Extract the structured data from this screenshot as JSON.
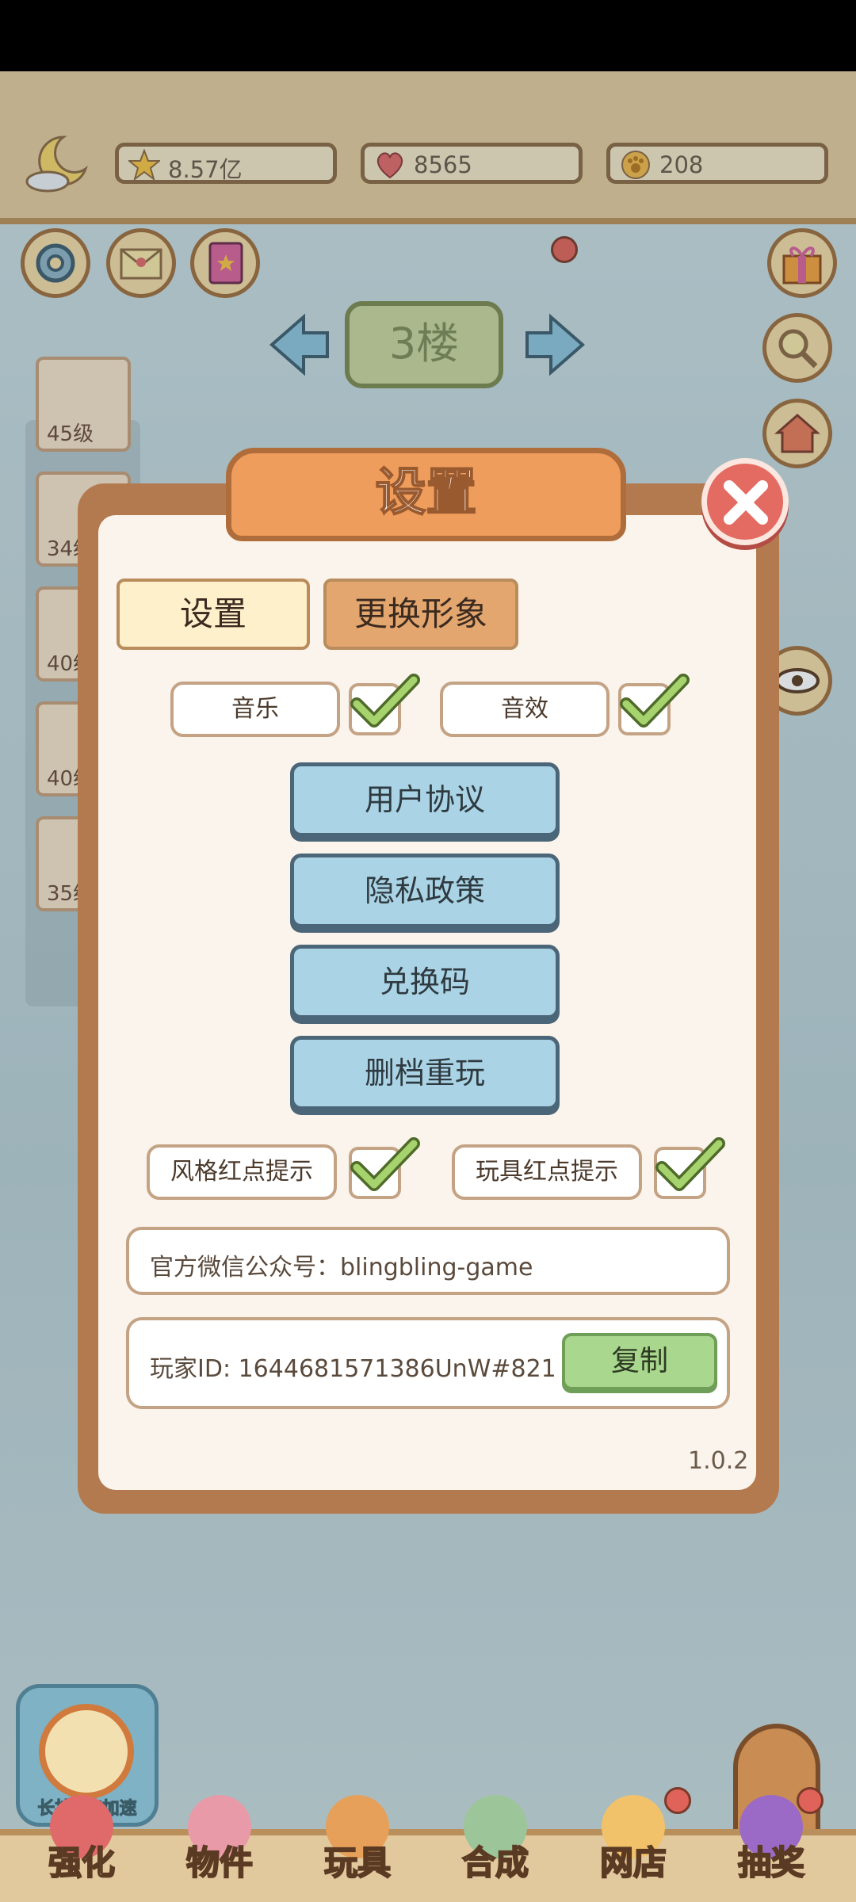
{
  "resources": {
    "stars": "8.57亿",
    "hearts": "8565",
    "coins": "208"
  },
  "floor": {
    "label": "3楼"
  },
  "levels": [
    "45级",
    "34级",
    "40级",
    "40级",
    "35级"
  ],
  "dialog": {
    "title": "设置",
    "tabs": {
      "settings": "设置",
      "change_avatar": "更换形象"
    },
    "toggles": {
      "music": {
        "label": "音乐",
        "checked": true
      },
      "sound": {
        "label": "音效",
        "checked": true
      },
      "style_dot": {
        "label": "风格红点提示",
        "checked": true
      },
      "toy_dot": {
        "label": "玩具红点提示",
        "checked": true
      }
    },
    "buttons": {
      "user_agreement": "用户协议",
      "privacy_policy": "隐私政策",
      "redeem_code": "兑换码",
      "delete_restart": "删档重玩"
    },
    "wechat": "官方微信公众号：blingbling-game",
    "player_id": "玩家ID: 1644681571386UnW#821",
    "copy_label": "复制",
    "version": "1.0.2"
  },
  "speedup_label": "长按3倍加速",
  "nav": [
    "强化",
    "物件",
    "玩具",
    "合成",
    "网店",
    "抽奖"
  ],
  "colors": {
    "accent_orange": "#ef9d5c",
    "button_blue": "#aad4e6",
    "check_green": "#a6d36d",
    "close_red": "#e46b62"
  }
}
